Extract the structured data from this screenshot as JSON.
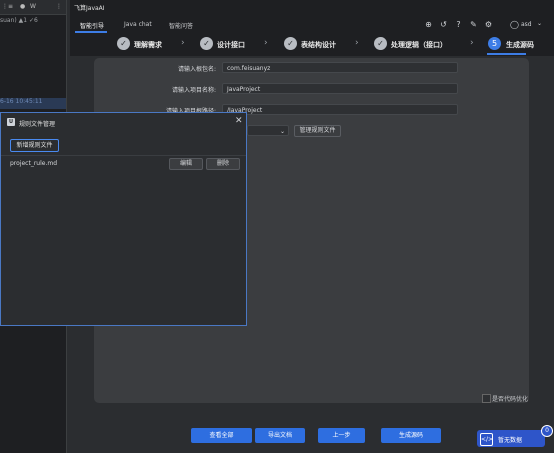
{
  "app": {
    "title": "飞算JavaAI"
  },
  "ide": {
    "tab_label": "W",
    "status_line": "suan) ▲1 ✓6",
    "timestamp_line": "6-16 10:45:11"
  },
  "nav": {
    "tabs": [
      {
        "label": "智能引导"
      },
      {
        "label": "Java chat"
      },
      {
        "label": "智能问答"
      }
    ],
    "user": "asd"
  },
  "steps": [
    {
      "num": "✓",
      "label": "理解需求"
    },
    {
      "num": "✓",
      "label": "设计接口"
    },
    {
      "num": "✓",
      "label": "表结构设计"
    },
    {
      "num": "✓",
      "label": "处理逻辑（接口）"
    },
    {
      "num": "5",
      "label": "生成源码"
    }
  ],
  "form": {
    "package_label": "请输入根包名:",
    "package_value": "com.feisuanyz",
    "project_name_label": "请输入项目名称:",
    "project_name_value": "JavaProject",
    "project_path_label": "请输入项目根路径:",
    "project_path_value": "/JavaProject",
    "manage_rules_button": "管理规则文件",
    "optimize_label": "是否代码优化"
  },
  "bottom_buttons": {
    "view_all": "查看全部",
    "export_doc": "导出文档",
    "prev_step": "上一步",
    "generate_code": "生成源码"
  },
  "badge": {
    "label": "暂无数据",
    "count": "0"
  },
  "modal": {
    "title": "规则文件管理",
    "new_rule_button": "新增规则文件",
    "files": [
      {
        "name": "project_rule.md"
      }
    ],
    "edit_button": "编辑",
    "delete_button": "删除"
  },
  "colors": {
    "accent": "#3d7de6",
    "panel": "#3b3d40",
    "background": "#2b2d30"
  }
}
